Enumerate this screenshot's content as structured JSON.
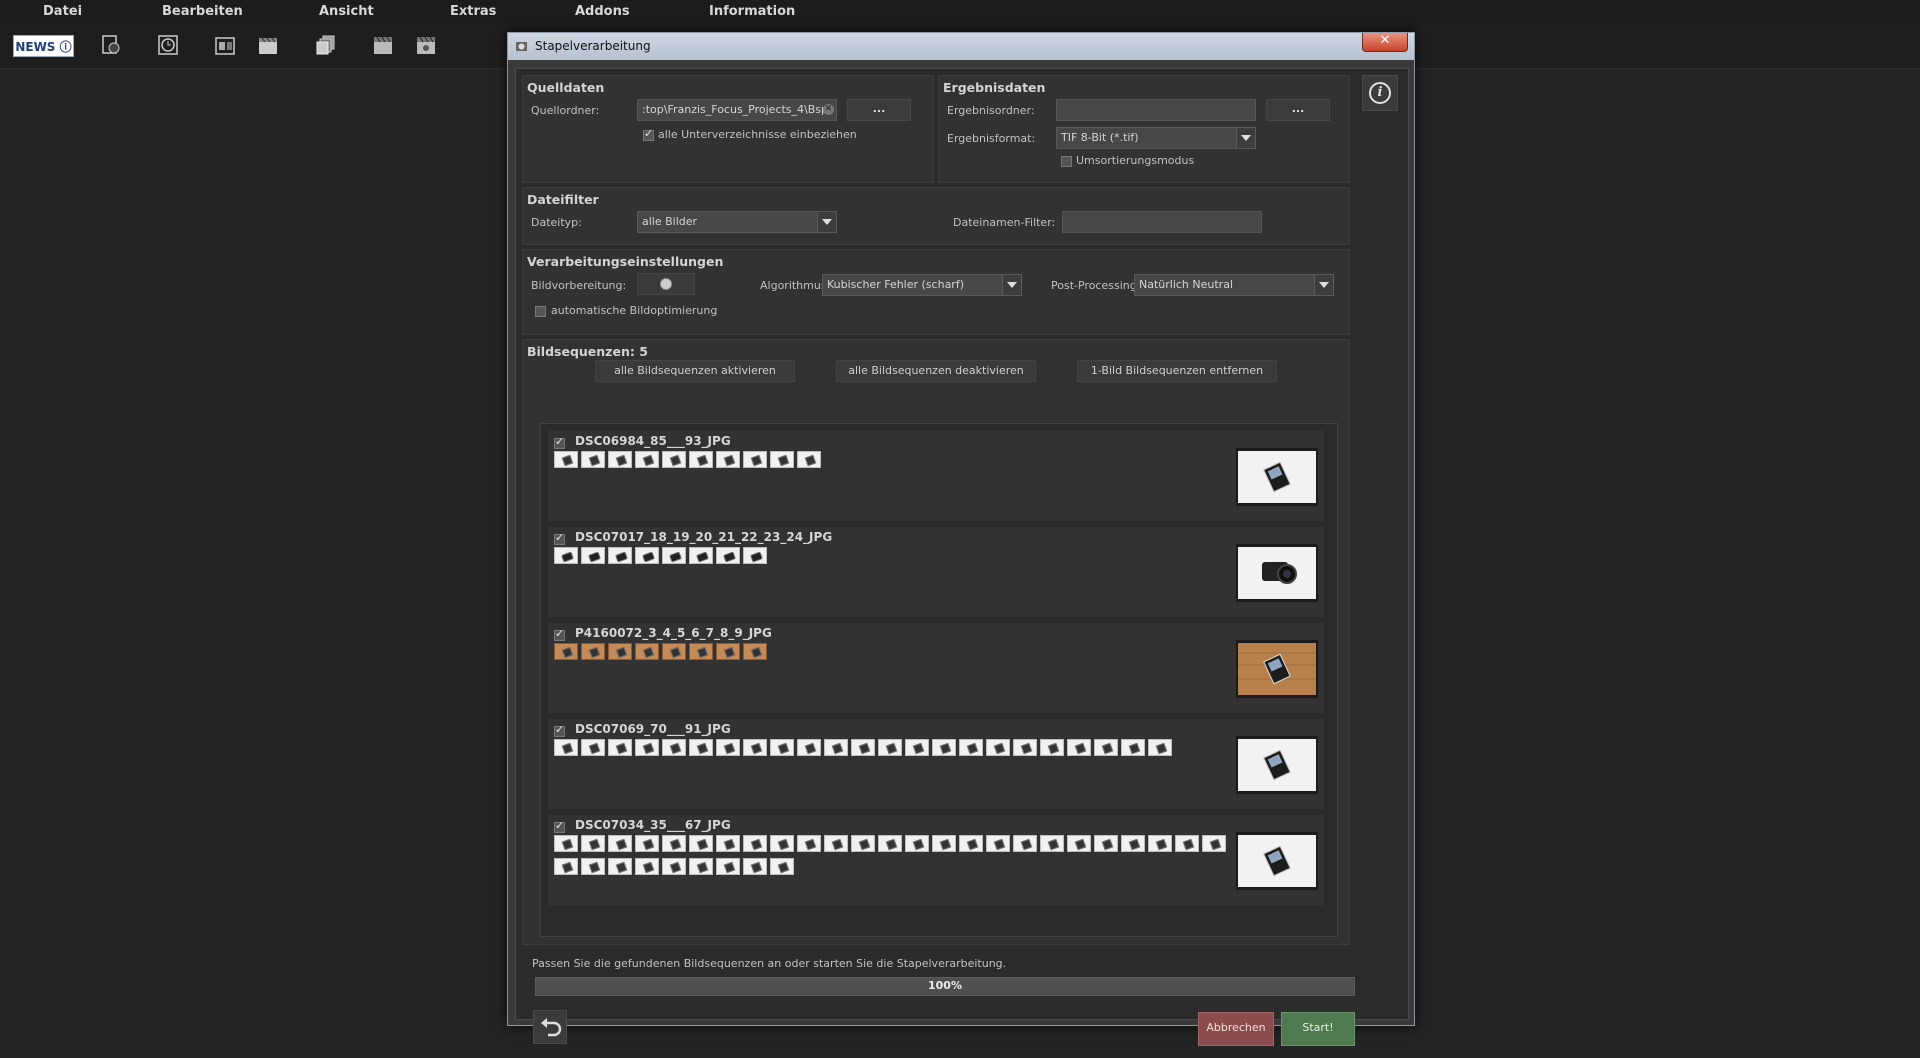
{
  "menu": [
    "Datei",
    "Bearbeiten",
    "Ansicht",
    "Extras",
    "Addons",
    "Information"
  ],
  "toolbar": {
    "news_label": "NEWS",
    "icons": [
      "document-icon",
      "history-icon",
      "gallery-icon",
      "clapperboard-icon",
      "stack-icon",
      "batch-film-icon",
      "batch-film-alt-icon"
    ]
  },
  "dialog": {
    "title": "Stapelverarbeitung",
    "close_label": "x",
    "quelldaten": {
      "title": "Quelldaten",
      "folder_label": "Quellordner:",
      "folder_value": ":top\\Franzis_Focus_Projects_4\\Bsp",
      "browse_label": "...",
      "subdirs_label": "alle Unterverzeichnisse einbeziehen",
      "subdirs_checked": true
    },
    "ergebnisdaten": {
      "title": "Ergebnisdaten",
      "folder_label": "Ergebnisordner:",
      "folder_value": "",
      "browse_label": "...",
      "format_label": "Ergebnisformat:",
      "format_value": "TIF 8-Bit (*.tif)",
      "sort_label": "Umsortierungsmodus",
      "sort_checked": false
    },
    "dateifilter": {
      "title": "Dateifilter",
      "type_label": "Dateityp:",
      "type_value": "alle Bilder",
      "name_filter_label": "Dateinamen-Filter:",
      "name_filter_value": ""
    },
    "verarbeitung": {
      "title": "Verarbeitungseinstellungen",
      "prep_label": "Bildvorbereitung:",
      "algo_label": "Algorithmus:",
      "algo_value": "Kubischer Fehler (scharf)",
      "post_label": "Post-Processing:",
      "post_value": "Natürlich Neutral",
      "auto_opt_label": "automatische Bildoptimierung",
      "auto_opt_checked": false
    },
    "sequences": {
      "title": "Bildsequenzen: 5",
      "btn_activate": "alle Bildsequenzen aktivieren",
      "btn_deactivate": "alle Bildsequenzen  deaktivieren",
      "btn_remove_single": "1-Bild Bildsequenzen entfernen",
      "items": [
        {
          "name": "DSC06984_85___93_JPG",
          "checked": true,
          "frames": 10,
          "thumb_style": "card",
          "preview": "sd-card-white"
        },
        {
          "name": "DSC07017_18_19_20_21_22_23_24_JPG",
          "checked": true,
          "frames": 8,
          "thumb_style": "camera",
          "preview": "camera-white"
        },
        {
          "name": "P4160072_3_4_5_6_7_8_9_JPG",
          "checked": true,
          "frames": 8,
          "thumb_style": "wood",
          "preview": "sd-card-wood"
        },
        {
          "name": "DSC07069_70___91_JPG",
          "checked": true,
          "frames": 23,
          "thumb_style": "card",
          "preview": "sd-card-white"
        },
        {
          "name": "DSC07034_35___67_JPG",
          "checked": true,
          "frames": 34,
          "thumb_style": "card",
          "preview": "sd-card-white"
        }
      ]
    },
    "status_text": "Passen Sie die gefundenen Bildsequenzen an oder starten Sie die Stapelverarbeitung.",
    "progress": {
      "percent": 100,
      "label": "100%"
    },
    "cancel_label": "Abbrechen",
    "start_label": "Start!"
  },
  "colors": {
    "background": "#232323",
    "panel": "#323232",
    "cancel": "#8a4c4c",
    "start": "#4f7a4f",
    "titlebar": "#c3ccd8"
  }
}
